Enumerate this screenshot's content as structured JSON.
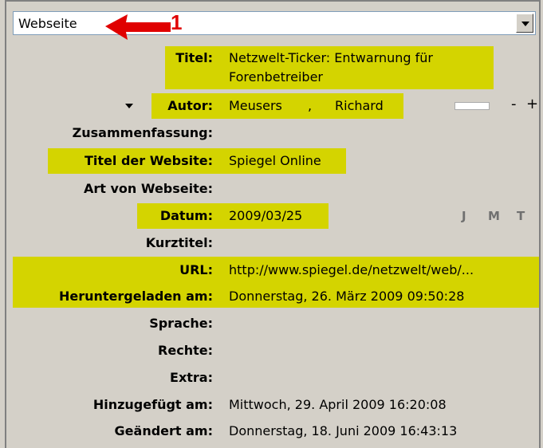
{
  "type_select": {
    "value": "Webseite"
  },
  "annotation": {
    "number": "1"
  },
  "fields": [
    {
      "label": "Titel:",
      "value_lines": [
        "Netzwelt-Ticker: Entwarnung für",
        "Forenbetreiber"
      ]
    },
    {
      "label": "Autor:",
      "last_name": "Meusers",
      "separator": ",",
      "first_name": "Richard",
      "remove": "-",
      "add": "+"
    },
    {
      "label": "Zusammenfassung:",
      "value": ""
    },
    {
      "label": "Titel der Website:",
      "value": "Spiegel Online"
    },
    {
      "label": "Art von Webseite:",
      "value": ""
    },
    {
      "label": "Datum:",
      "value": "2009/03/25",
      "order": [
        "J",
        "M",
        "T"
      ]
    },
    {
      "label": "Kurztitel:",
      "value": ""
    },
    {
      "label": "URL:",
      "value": "http://www.spiegel.de/netzwelt/web/..."
    },
    {
      "label": "Heruntergeladen am:",
      "value": "Donnerstag, 26. März 2009 09:50:28"
    },
    {
      "label": "Sprache:",
      "value": ""
    },
    {
      "label": "Rechte:",
      "value": ""
    },
    {
      "label": "Extra:",
      "value": ""
    },
    {
      "label": "Hinzugefügt am:",
      "value": "Mittwoch, 29. April 2009 16:20:08"
    },
    {
      "label": "Geändert am:",
      "value": "Donnerstag, 18. Juni 2009 16:43:13"
    }
  ],
  "colors": {
    "highlight": "#d4d400",
    "annotation": "#e00000",
    "panel": "#d4d0c8"
  },
  "icons": {
    "dropdown": "chevron-down-icon",
    "annotation_arrow": "arrow-left-icon",
    "author_menu": "triangle-down-icon"
  }
}
